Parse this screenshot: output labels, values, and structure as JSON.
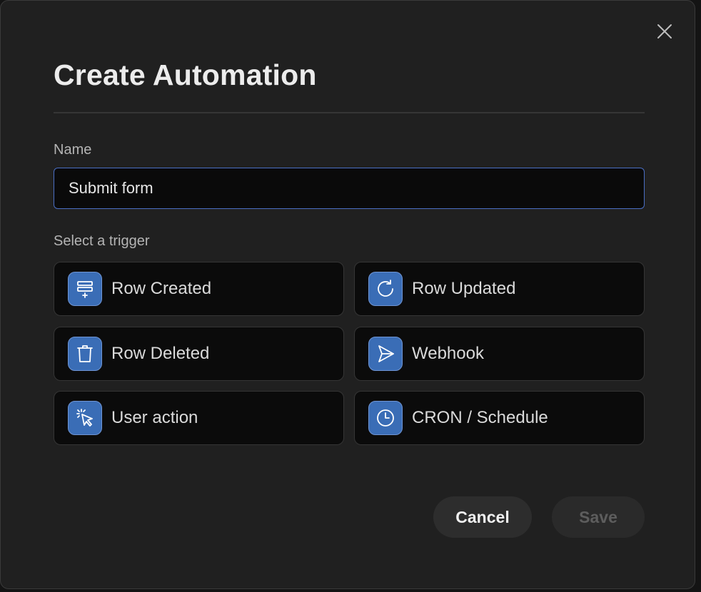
{
  "dialog": {
    "title": "Create Automation",
    "close_icon": "close-icon"
  },
  "name_field": {
    "label": "Name",
    "value": "Submit form"
  },
  "triggers": {
    "label": "Select a trigger",
    "items": [
      {
        "label": "Row Created",
        "icon": "row-created-icon"
      },
      {
        "label": "Row Updated",
        "icon": "refresh-icon"
      },
      {
        "label": "Row Deleted",
        "icon": "trash-icon"
      },
      {
        "label": "Webhook",
        "icon": "send-icon"
      },
      {
        "label": "User action",
        "icon": "cursor-click-icon"
      },
      {
        "label": "CRON / Schedule",
        "icon": "clock-icon"
      }
    ]
  },
  "footer": {
    "cancel_label": "Cancel",
    "save_label": "Save"
  },
  "colors": {
    "accent": "#3a6db6",
    "input_focus_border": "#4a6ec4",
    "background": "#202020"
  }
}
